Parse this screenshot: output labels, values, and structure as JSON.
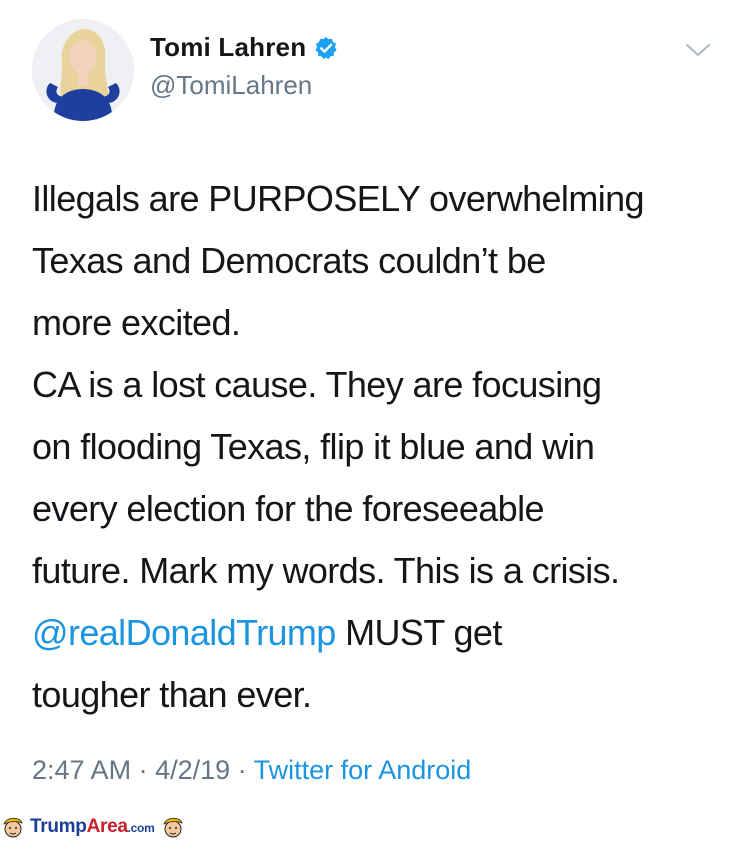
{
  "tweet": {
    "author_name": "Tomi Lahren",
    "author_handle": "@TomiLahren",
    "verified": true,
    "body_lines": [
      "Illegals are PURPOSELY overwhelming",
      "Texas and Democrats couldn’t be",
      "more excited.",
      "CA is a lost cause. They are focusing",
      "on flooding Texas, flip it blue and win",
      "every election for the foreseeable",
      "future. Mark my words. This is a crisis."
    ],
    "mention": "@realDonaldTrump",
    "after_mention": " MUST get",
    "last_line": "tougher than ever.",
    "time": "2:47 AM",
    "separator": " · ",
    "date": "4/2/19",
    "source": "Twitter for Android"
  },
  "watermark": {
    "part1": "Trump",
    "part2": "Area",
    "part3": ".com"
  },
  "colors": {
    "link_blue": "#1b95e0",
    "muted_gray": "#657786",
    "text_dark": "#14171a",
    "verified_blue": "#1da1f2"
  },
  "icons": [
    "verified-badge-icon",
    "chevron-down-icon",
    "cartoon-face-icon"
  ]
}
